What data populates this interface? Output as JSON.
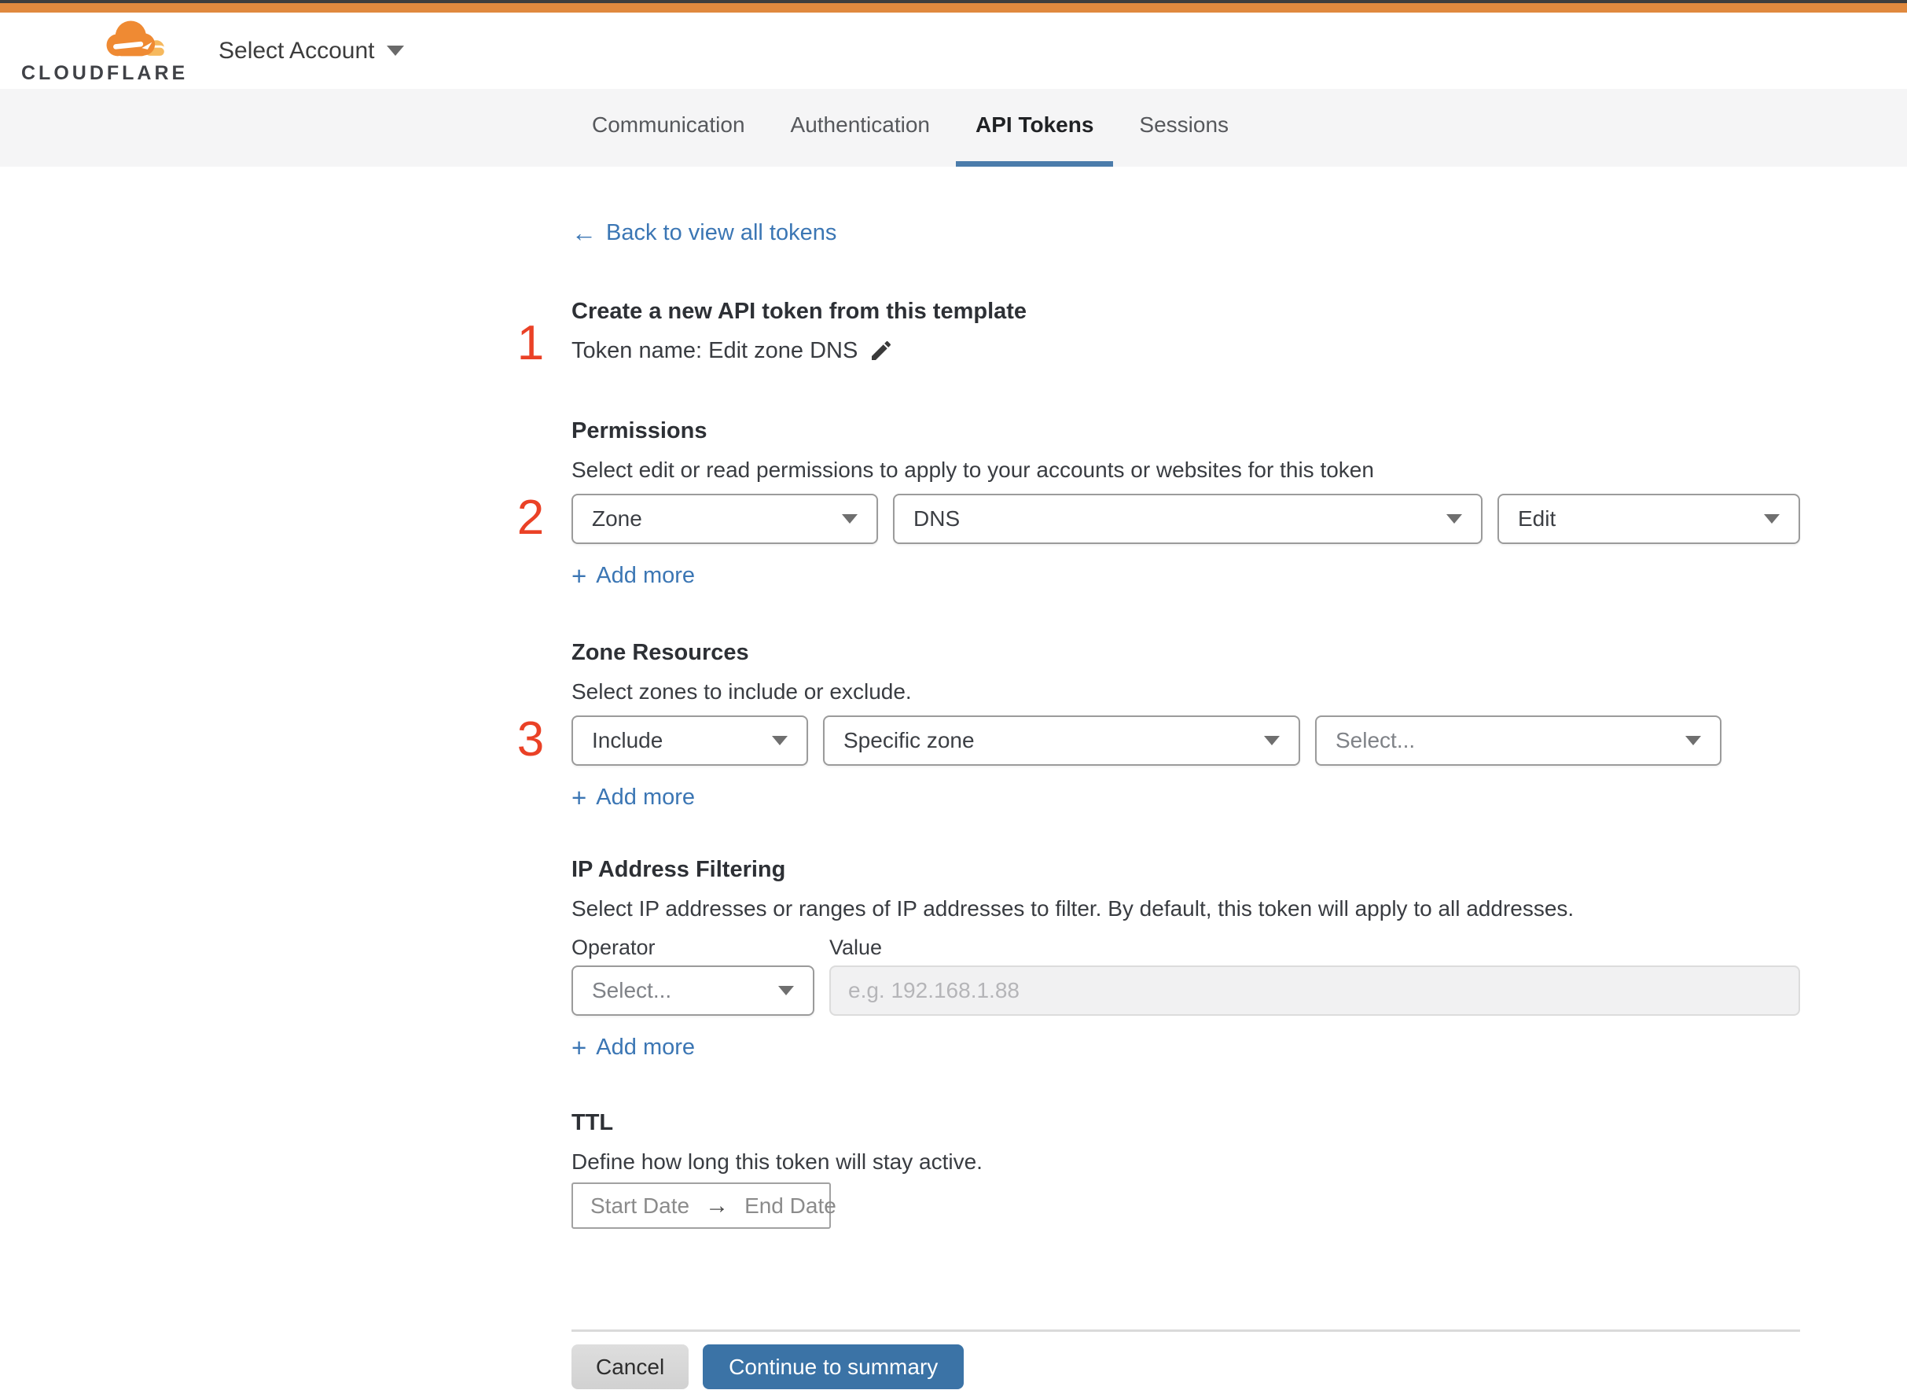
{
  "colors": {
    "top_accent_orange": "#e0893e",
    "brand_orange": "#ef8a33",
    "brand_orange_light": "#f6b95e",
    "step_number_red": "#ea4126",
    "link_blue": "#3b76b4",
    "active_tab_underline_blue": "#4b7cab",
    "continue_button_blue": "#3b73a6",
    "tabbar_background": "#f5f5f6"
  },
  "icons": {
    "back_arrow": "←",
    "range_arrow": "→",
    "plus": "+"
  },
  "header": {
    "wordmark": "CLOUDFLARE",
    "account_selector_label": "Select Account"
  },
  "tabs": {
    "items": [
      {
        "label": "Communication"
      },
      {
        "label": "Authentication"
      },
      {
        "label": "API Tokens"
      },
      {
        "label": "Sessions"
      }
    ],
    "active": "API Tokens"
  },
  "page": {
    "back_link_label": "Back to view all tokens",
    "step1": {
      "number": "1",
      "title": "Create a new API token from this template",
      "token_name_line": "Token name: Edit zone DNS"
    },
    "step2": {
      "number": "2",
      "title": "Permissions",
      "subtitle": "Select edit or read permissions to apply to your accounts or websites for this token",
      "dropdowns": [
        {
          "value": "Zone"
        },
        {
          "value": "DNS"
        },
        {
          "value": "Edit"
        }
      ],
      "add_more_label": "Add more"
    },
    "step3": {
      "number": "3",
      "title": "Zone Resources",
      "subtitle": "Select zones to include or exclude.",
      "dropdowns": [
        {
          "value": "Include"
        },
        {
          "value": "Specific zone"
        },
        {
          "value": "Select..."
        }
      ],
      "add_more_label": "Add more"
    },
    "ip_filtering": {
      "title": "IP Address Filtering",
      "subtitle": "Select IP addresses or ranges of IP addresses to filter. By default, this token will apply to all addresses.",
      "operator_label": "Operator",
      "value_label": "Value",
      "operator_dropdown_value": "Select...",
      "value_placeholder": "e.g. 192.168.1.88",
      "add_more_label": "Add more"
    },
    "ttl": {
      "title": "TTL",
      "subtitle": "Define how long this token will stay active.",
      "start_date_label": "Start Date",
      "end_date_label": "End Date"
    },
    "footer": {
      "cancel_label": "Cancel",
      "continue_label": "Continue to summary"
    }
  }
}
